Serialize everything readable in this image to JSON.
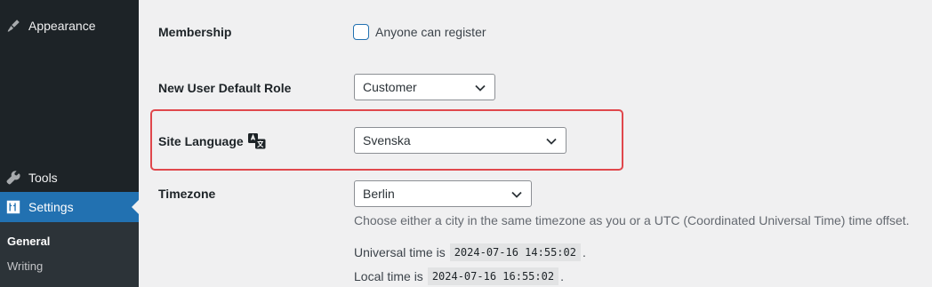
{
  "sidebar": {
    "appearance": "Appearance",
    "tools": "Tools",
    "settings": "Settings",
    "submenu": {
      "general": "General",
      "writing": "Writing"
    },
    "active_color": "#2271b1",
    "bg_color": "#1d2327"
  },
  "settings": {
    "membership": {
      "label": "Membership",
      "checkbox_label": "Anyone can register",
      "checked": false
    },
    "default_role": {
      "label": "New User Default Role",
      "value": "Customer"
    },
    "site_language": {
      "label": "Site Language",
      "value": "Svenska",
      "icon": "translation-icon"
    },
    "timezone": {
      "label": "Timezone",
      "value": "Berlin",
      "description": "Choose either a city in the same timezone as you or a UTC (Coordinated Universal Time) time offset.",
      "universal_label": "Universal time is",
      "universal_value": "2024-07-16 14:55:02",
      "local_label": "Local time is",
      "local_value": "2024-07-16 16:55:02",
      "period": "."
    }
  },
  "highlight_color": "#e0474c"
}
